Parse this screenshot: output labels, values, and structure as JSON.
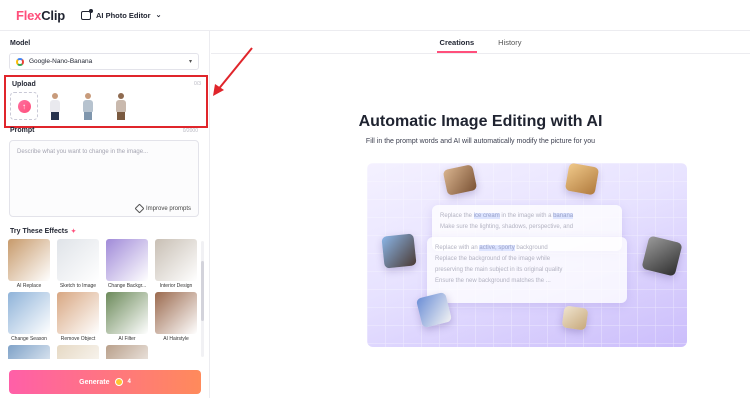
{
  "topbar": {
    "logo_flex": "Flex",
    "logo_clip": "Clip",
    "editor_label": "AI Photo Editor",
    "editor_icon": "photo-edit-icon"
  },
  "left": {
    "model_label": "Model",
    "model_value": "Google-Nano-Banana",
    "upload_label": "Upload",
    "upload_count": "0/3",
    "prompt_label": "Prompt",
    "prompt_counter": "0/2000",
    "prompt_placeholder": "Describe what you want to change in the image...",
    "improve_label": "Improve prompts",
    "effects_label": "Try These Effects",
    "effects": [
      {
        "name": "AI Replace",
        "color": "#c79a6b"
      },
      {
        "name": "Sketch to Image",
        "color": "#dfe3e8"
      },
      {
        "name": "Change Backgr...",
        "color": "#a08ad8"
      },
      {
        "name": "Interior Design",
        "color": "#c8bfb4"
      },
      {
        "name": "Change Season",
        "color": "#8fb3d9"
      },
      {
        "name": "Remove Object",
        "color": "#d8a782"
      },
      {
        "name": "AI Filter",
        "color": "#6c8a5a"
      },
      {
        "name": "AI Hairstyle",
        "color": "#9b6a4e"
      },
      {
        "name": "",
        "color": "#7fa2c8"
      },
      {
        "name": "",
        "color": "#e6d9c4"
      },
      {
        "name": "",
        "color": "#b9a08b"
      },
      {
        "name": "",
        "color": "#ffffff"
      }
    ],
    "generate_label": "Generate",
    "generate_cost": "4"
  },
  "right": {
    "tabs": [
      "Creations",
      "History"
    ],
    "heading": "Automatic Image Editing with AI",
    "subheading": "Fill in the prompt words and AI will automatically modify the picture for you",
    "card1_lines": [
      "Replace the ",
      "ice cream",
      " in the image with a ",
      "banana",
      "Make sure the lighting, shadows, perspective, and"
    ],
    "card2_lines": [
      "Replace with an ",
      "active, sporty",
      " background",
      "Replace the background of the image while",
      "preserving the main subject in its original quality",
      "Ensure the new background matches the ..."
    ]
  }
}
